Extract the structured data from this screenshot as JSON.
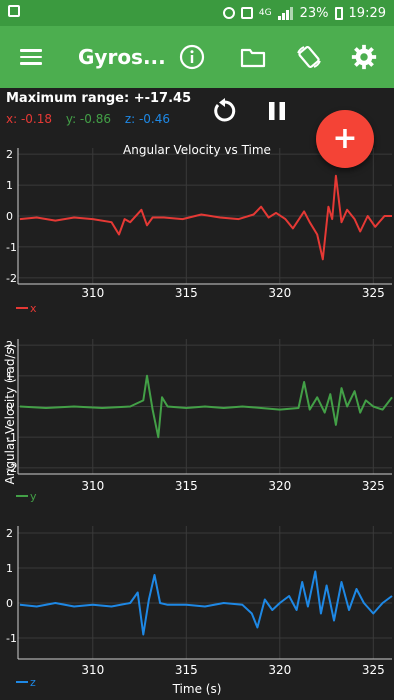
{
  "status_bar": {
    "network": "4G",
    "battery": "23%",
    "time": "19:29"
  },
  "app_bar": {
    "title": "Gyros..."
  },
  "readout": {
    "max_range": "Maximum range: +-17.45",
    "x": "x: -0.18",
    "y": "y: -0.86",
    "z": "z: -0.46"
  },
  "colors": {
    "x": "#e53935",
    "y": "#43a047",
    "z": "#1e88e5",
    "app_bar": "#4cae4f",
    "fab": "#f44336"
  },
  "icons": [
    "menu-icon",
    "info-icon",
    "folder-icon",
    "rotate-screen-icon",
    "gear-icon",
    "reset-icon",
    "pause-icon",
    "plus-icon"
  ],
  "chart_data": {
    "type": "line",
    "title": "Angular Velocity vs Time",
    "xlabel": "Time (s)",
    "ylabel": "Angular Velocity (rad/s)",
    "xlim": [
      306,
      326
    ],
    "x_ticks": [
      310,
      315,
      320,
      325
    ],
    "grid": true,
    "panels": [
      {
        "name": "x",
        "ylim": [
          -2.2,
          2.2
        ],
        "y_ticks": [
          2,
          1,
          0,
          -1,
          -2
        ],
        "x": [
          306.1,
          307.0,
          308.0,
          309.0,
          310.0,
          311.0,
          311.4,
          311.7,
          312.0,
          312.6,
          312.9,
          313.2,
          313.8,
          314.8,
          315.8,
          316.8,
          317.8,
          318.6,
          319.0,
          319.4,
          319.8,
          320.3,
          320.7,
          321.3,
          321.6,
          322.0,
          322.3,
          322.6,
          322.8,
          323.0,
          323.3,
          323.6,
          324.0,
          324.3,
          324.7,
          325.1,
          325.6,
          326.0
        ],
        "values": [
          -0.1,
          -0.05,
          -0.15,
          -0.05,
          -0.1,
          -0.2,
          -0.6,
          -0.1,
          -0.2,
          0.2,
          -0.3,
          -0.05,
          -0.05,
          -0.1,
          0.05,
          -0.05,
          -0.1,
          0.05,
          0.3,
          -0.05,
          0.1,
          -0.1,
          -0.4,
          0.15,
          -0.2,
          -0.6,
          -1.4,
          0.3,
          -0.1,
          1.3,
          -0.2,
          0.2,
          -0.1,
          -0.5,
          0.0,
          -0.35,
          0.0,
          0.0
        ]
      },
      {
        "name": "y",
        "ylim": [
          -2.2,
          2.2
        ],
        "y_ticks": [
          2,
          1,
          0,
          -1,
          -2
        ],
        "x": [
          306.1,
          307.5,
          309.0,
          310.5,
          312.0,
          312.7,
          312.9,
          313.2,
          313.5,
          313.7,
          314.0,
          315.0,
          316.0,
          317.0,
          318.0,
          319.0,
          320.0,
          321.0,
          321.3,
          321.6,
          322.0,
          322.4,
          322.7,
          323.0,
          323.3,
          323.6,
          324.0,
          324.3,
          324.6,
          325.0,
          325.5,
          326.0
        ],
        "values": [
          0.0,
          -0.05,
          0.0,
          -0.05,
          0.0,
          0.2,
          1.0,
          -0.1,
          -1.0,
          0.3,
          0.0,
          -0.05,
          0.0,
          -0.05,
          0.0,
          -0.05,
          -0.1,
          -0.05,
          0.8,
          -0.1,
          0.3,
          -0.2,
          0.4,
          -0.6,
          0.6,
          0.0,
          0.5,
          -0.2,
          0.2,
          0.0,
          -0.1,
          0.3
        ]
      },
      {
        "name": "z",
        "ylim": [
          -1.6,
          2.2
        ],
        "y_ticks": [
          2,
          1,
          0,
          -1
        ],
        "x": [
          306.1,
          307.0,
          308.0,
          309.0,
          310.0,
          311.0,
          312.0,
          312.4,
          312.7,
          313.0,
          313.3,
          313.6,
          314.0,
          315.0,
          316.0,
          317.0,
          318.0,
          318.5,
          318.8,
          319.2,
          319.6,
          320.0,
          320.5,
          320.9,
          321.2,
          321.5,
          321.9,
          322.2,
          322.5,
          322.9,
          323.3,
          323.7,
          324.1,
          324.5,
          325.0,
          325.5,
          326.0
        ],
        "values": [
          -0.05,
          -0.1,
          0.0,
          -0.1,
          -0.05,
          -0.1,
          0.0,
          0.3,
          -0.9,
          0.1,
          0.8,
          0.0,
          -0.05,
          -0.05,
          -0.1,
          0.0,
          -0.05,
          -0.3,
          -0.7,
          0.1,
          -0.2,
          0.0,
          0.2,
          -0.2,
          0.6,
          -0.1,
          0.9,
          -0.3,
          0.5,
          -0.5,
          0.6,
          -0.2,
          0.4,
          0.0,
          -0.3,
          0.0,
          0.2
        ]
      }
    ]
  }
}
